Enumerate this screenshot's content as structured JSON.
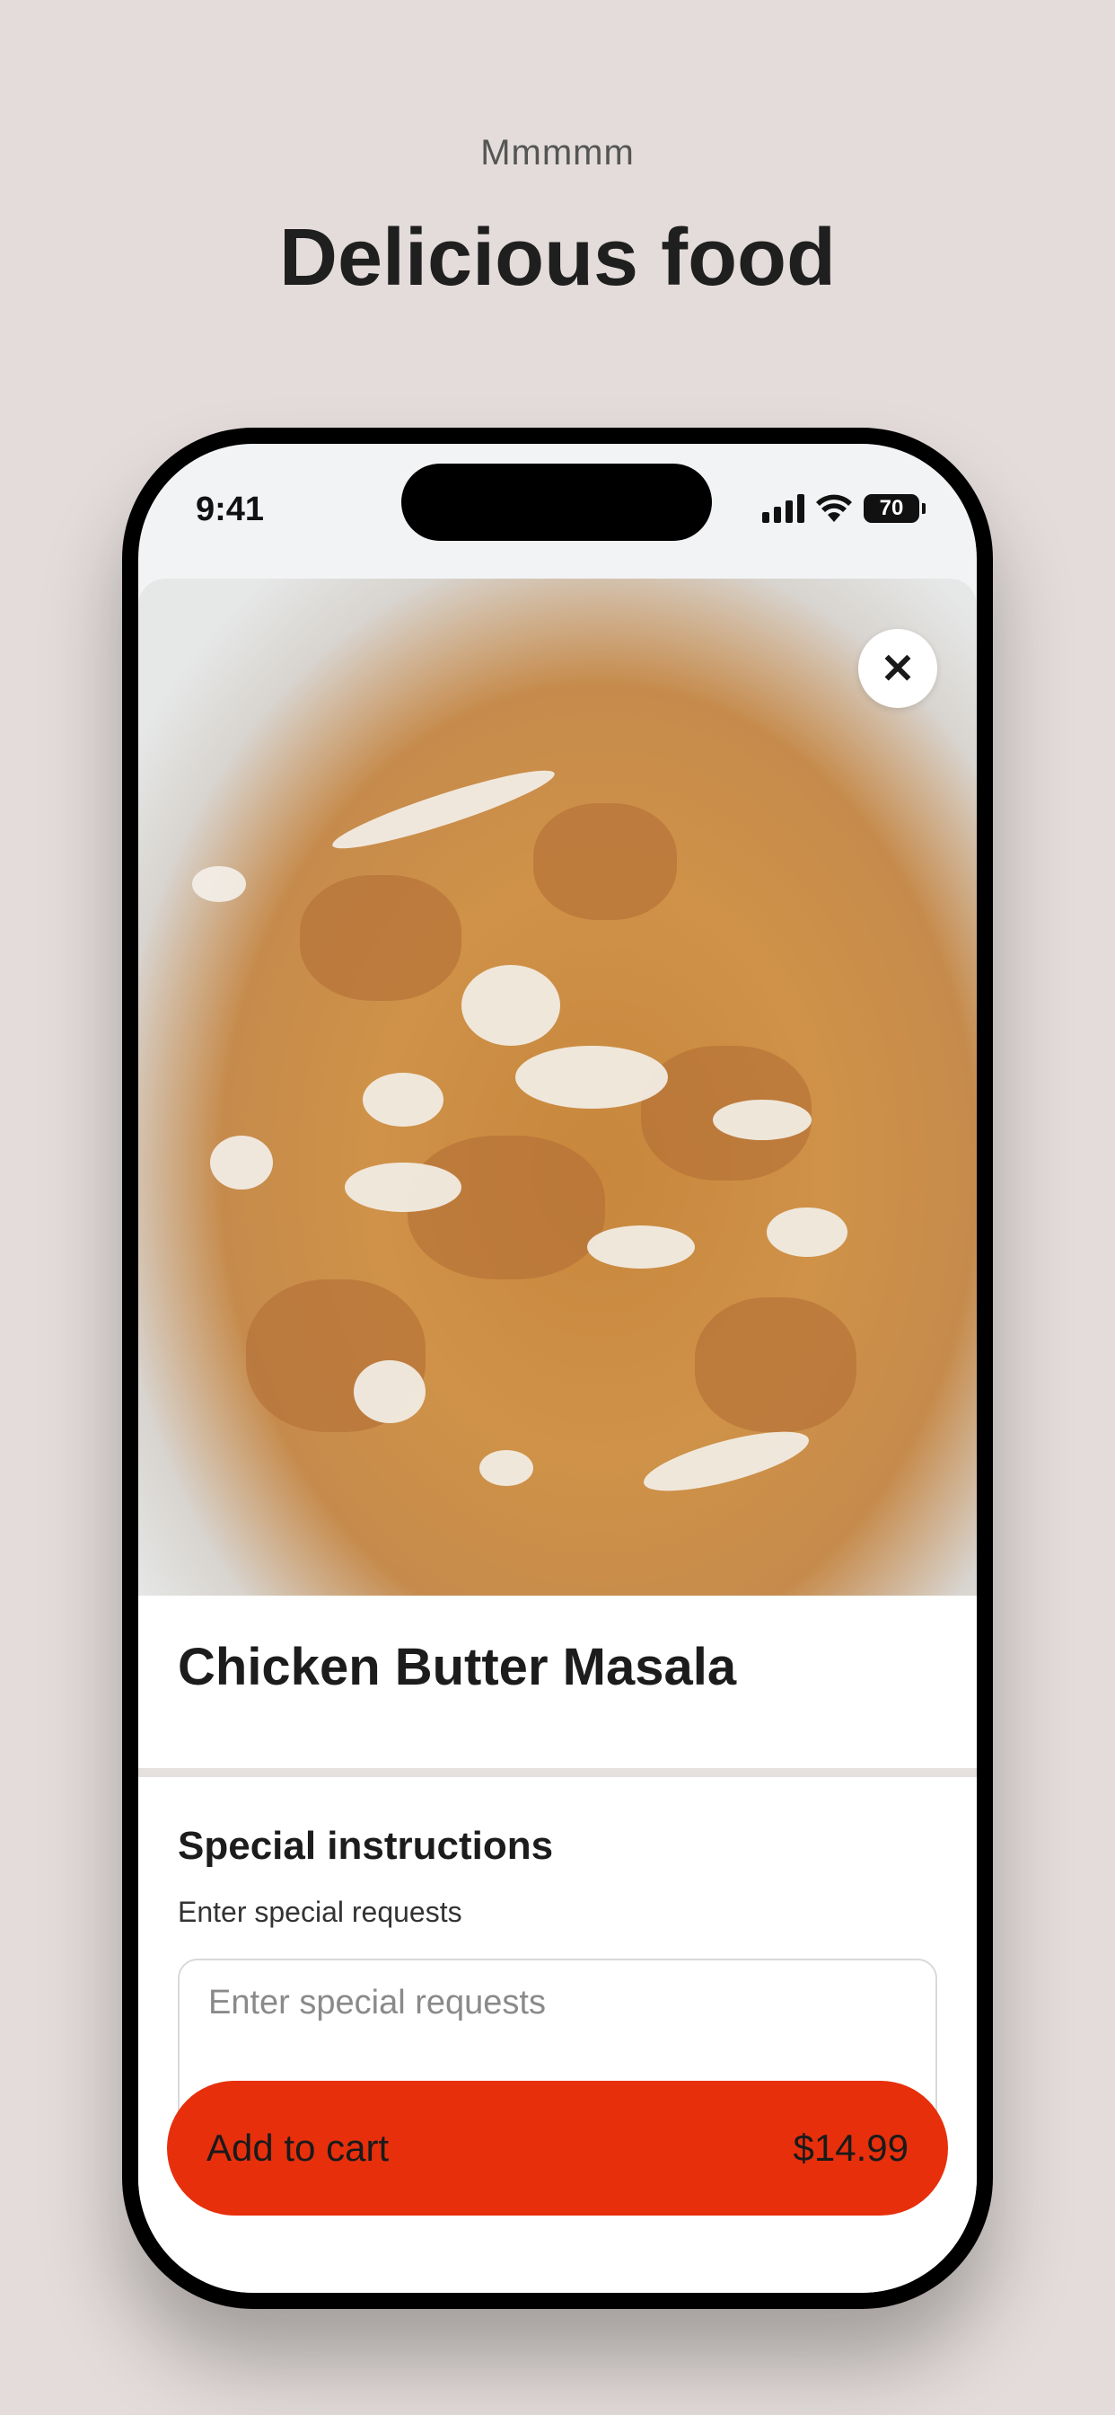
{
  "promo": {
    "eyebrow": "Mmmmm",
    "headline": "Delicious food"
  },
  "status_bar": {
    "time": "9:41",
    "battery": "70"
  },
  "item": {
    "image_alt": "Chicken Butter Masala dish",
    "title": "Chicken Butter Masala",
    "close_icon": "close-icon"
  },
  "special_instructions": {
    "title": "Special instructions",
    "subtitle": "Enter special requests",
    "placeholder": "Enter special requests",
    "value": ""
  },
  "cart": {
    "label": "Add to cart",
    "price": "$14.99"
  },
  "colors": {
    "background": "#e3dcda",
    "accent": "#e72f0c"
  }
}
